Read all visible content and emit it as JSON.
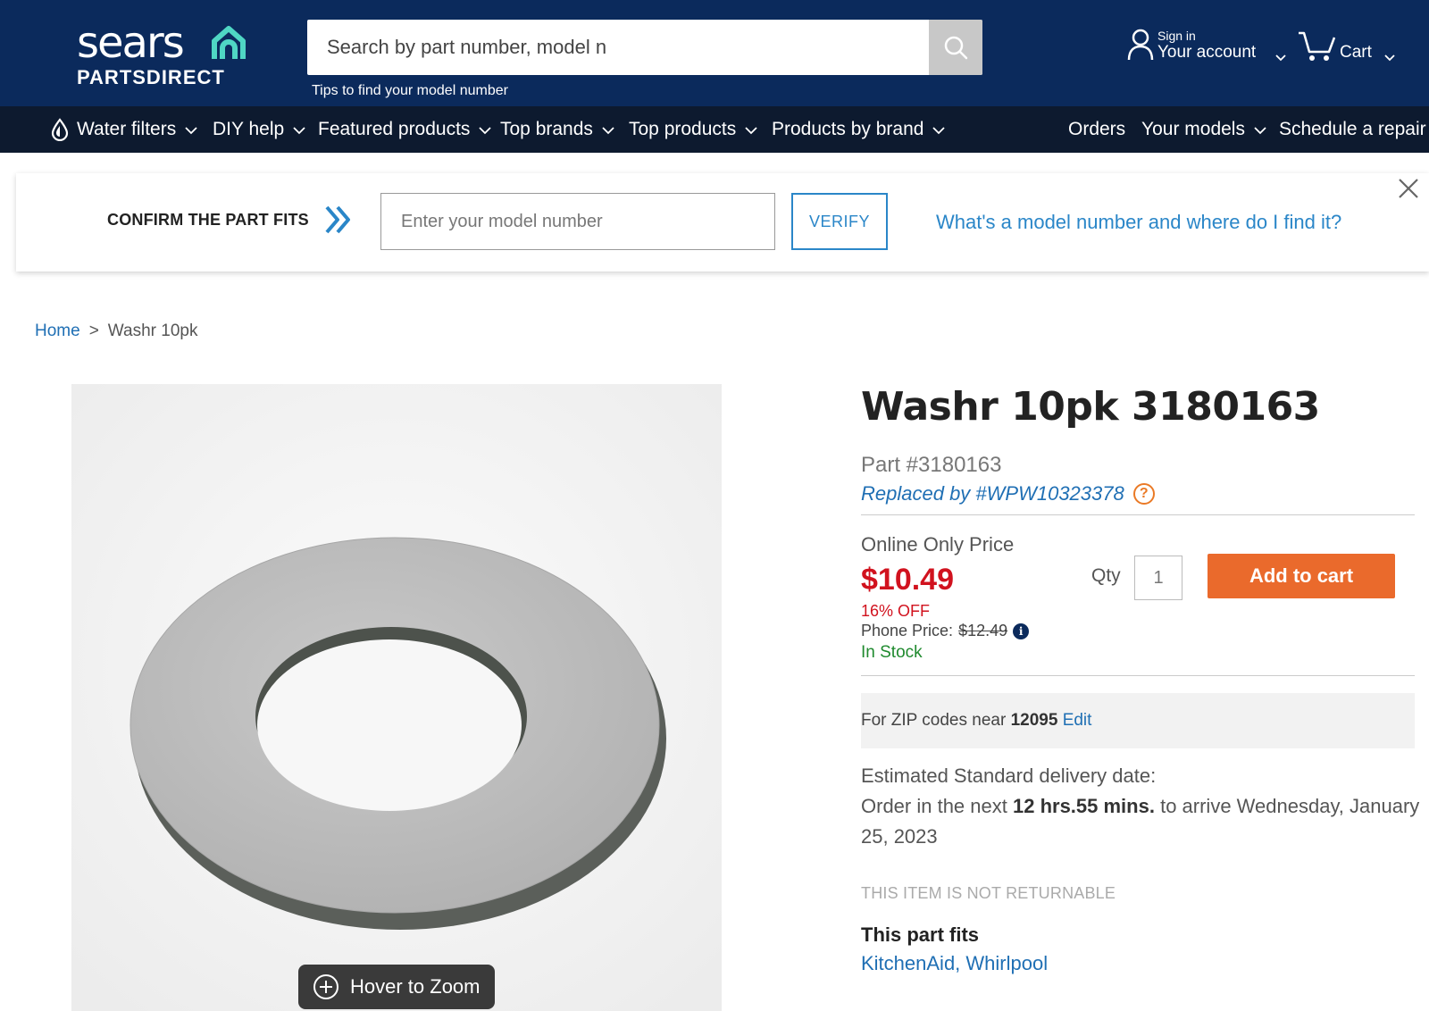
{
  "header": {
    "logo_word": "sears",
    "logo_sub": "PARTSDIRECT",
    "search_placeholder": "Search by part number, model n",
    "tips": "Tips to find your model number",
    "account_line1": "Sign in",
    "account_line2": "Your account",
    "cart_label": "Cart",
    "colors": {
      "header_bg": "#0b2a5c",
      "nav_bg": "#0d1a2f",
      "logo_accent": "#4fd6c4"
    },
    "icons": [
      "search-icon",
      "user-icon",
      "cart-icon",
      "water-drop-icon",
      "chevron-down-icon"
    ]
  },
  "nav": {
    "items": [
      {
        "label": "Water filters",
        "has_menu": true
      },
      {
        "label": "DIY help",
        "has_menu": true
      },
      {
        "label": "Featured products",
        "has_menu": true
      },
      {
        "label": "Top brands",
        "has_menu": true
      },
      {
        "label": "Top products",
        "has_menu": true
      },
      {
        "label": "Products by brand",
        "has_menu": true
      }
    ],
    "right_items": [
      {
        "label": "Orders",
        "has_menu": false
      },
      {
        "label": "Your models",
        "has_menu": true
      },
      {
        "label": "Schedule a repair",
        "has_menu": false
      }
    ]
  },
  "fit_bar": {
    "label": "CONFIRM THE PART FITS",
    "input_placeholder": "Enter your model number",
    "verify_label": "VERIFY",
    "help_link": "What's a model number and where do I find it?"
  },
  "breadcrumb": {
    "home": "Home",
    "separator": ">",
    "current": "Washr 10pk"
  },
  "image": {
    "zoom_label": "Hover to Zoom"
  },
  "product": {
    "title": "Washr 10pk 3180163",
    "part_number": "Part #3180163",
    "replaced_by": "Replaced by #WPW10323378",
    "help_mark": "?",
    "price_label": "Online Only Price",
    "price": "$10.49",
    "discount": "16% OFF",
    "phone_price_label": "Phone Price:",
    "phone_price": "$12.49",
    "info_mark": "i",
    "stock": "In Stock",
    "qty_label": "Qty",
    "qty_value": "1",
    "add_to_cart": "Add to cart",
    "colors": {
      "price": "#d1121e",
      "add_to_cart": "#ea6a2c",
      "stock": "#1f8a2e",
      "link": "#1f6fb4"
    }
  },
  "delivery": {
    "zip_prefix": "For ZIP codes near ",
    "zip": "12095",
    "zip_edit": "Edit",
    "estimated_label": "Estimated Standard delivery date:",
    "order_prefix": "Order in the next ",
    "order_time": "12 hrs.55 mins.",
    "order_suffix": " to arrive Wednesday, January 25, 2023",
    "not_returnable": "THIS ITEM IS NOT RETURNABLE",
    "fits_title": "This part fits",
    "fits_brands": "KitchenAid, Whirlpool"
  }
}
